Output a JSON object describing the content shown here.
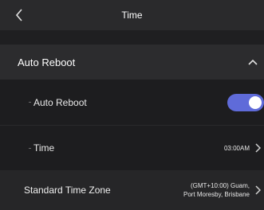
{
  "header": {
    "title": "Time"
  },
  "section": {
    "title": "Auto Reboot",
    "expanded": true
  },
  "rows": [
    {
      "label": "Auto Reboot",
      "type": "toggle",
      "enabled": true
    },
    {
      "label": "Time",
      "value": "03:00AM"
    },
    {
      "label": "Standard Time Zone",
      "value_line1": "(GMT+10:00) Guam,",
      "value_line2": "Port Moresby, Brisbane"
    }
  ],
  "colors": {
    "accent": "#5f6bd9",
    "background": "#1f1f21"
  },
  "icons": {
    "back": "chevron-left-icon",
    "collapse": "chevron-up-icon",
    "next": "chevron-right-icon"
  }
}
